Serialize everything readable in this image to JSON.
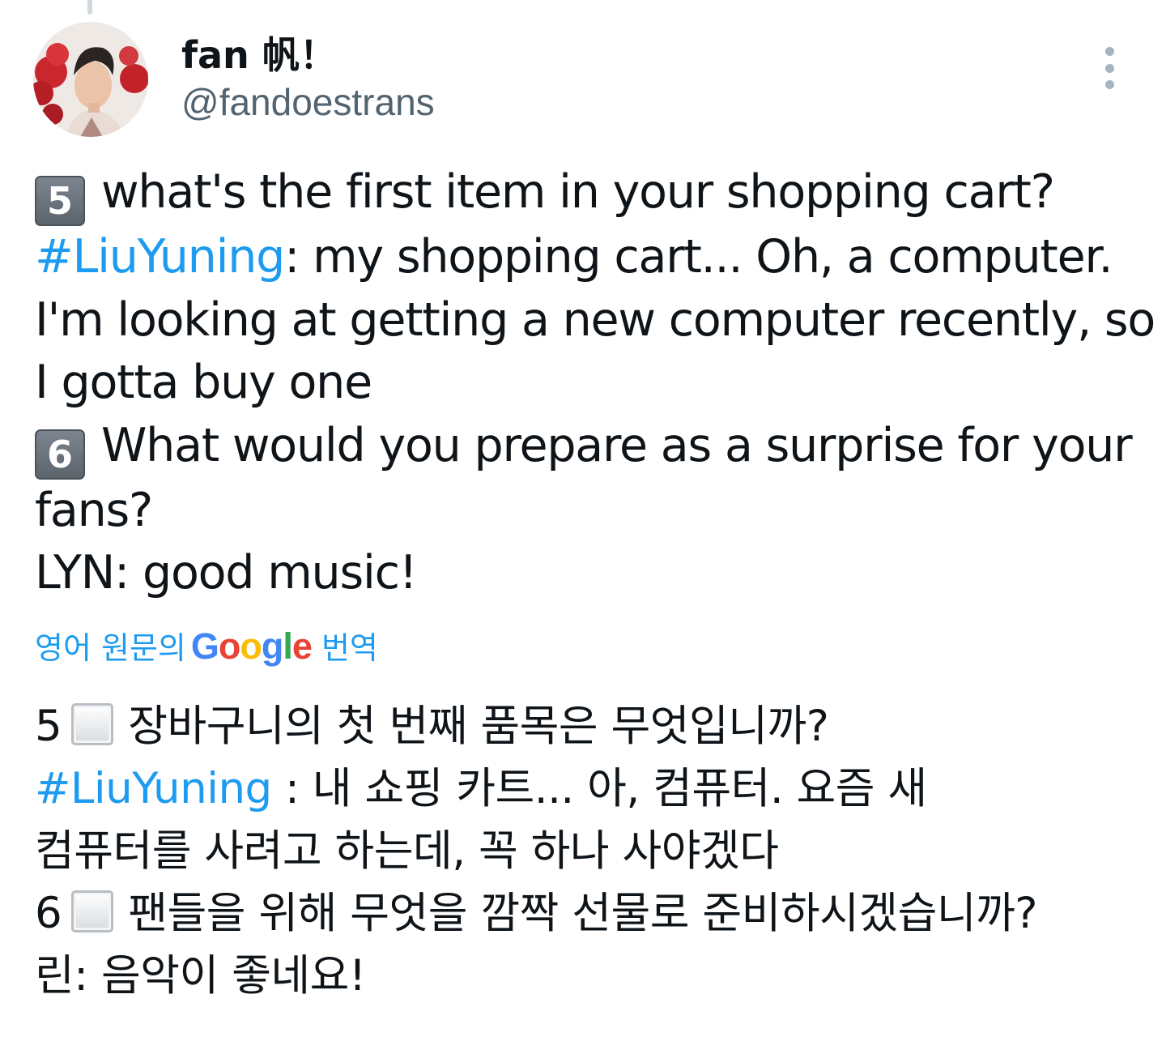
{
  "author": {
    "display_name": "fan 帆！",
    "handle": "@fandoestrans"
  },
  "tweet": {
    "q5_keycap": "5",
    "q5_question": "what's the first item in your shopping cart?",
    "q5_hashtag": "#LiuYuning",
    "q5_answer_part1": ": my shopping cart... Oh, a computer.",
    "q5_answer_part2": "I'm looking at getting a new computer recently, so",
    "q5_answer_part3": "I gotta buy one",
    "q6_keycap": "6",
    "q6_question_part1": "What would you prepare as a surprise for your",
    "q6_question_part2": "fans?",
    "q6_answer": "LYN: good music!"
  },
  "translate": {
    "prefix": "영어 원문의",
    "google": "Google",
    "suffix": "번역"
  },
  "translation": {
    "q5_number": "5",
    "q5_question": "장바구니의 첫 번째 품목은 무엇입니까?",
    "q5_hashtag": "#LiuYuning",
    "q5_answer_part1": " : 내 쇼핑 카트... 아, 컴퓨터. 요즘 새",
    "q5_answer_part2": "컴퓨터를 사려고 하는데, 꼭 하나 사야겠다",
    "q6_number": "6",
    "q6_question": "팬들을 위해 무엇을 깜짝 선물로 준비하시겠습니까?",
    "q6_answer": "린: 음악이 좋네요!"
  },
  "colors": {
    "link": "#1d9bf0",
    "text": "#0f1419",
    "secondary": "#536471"
  },
  "icons": {
    "more": "more-vertical-icon",
    "avatar": "profile-photo"
  }
}
